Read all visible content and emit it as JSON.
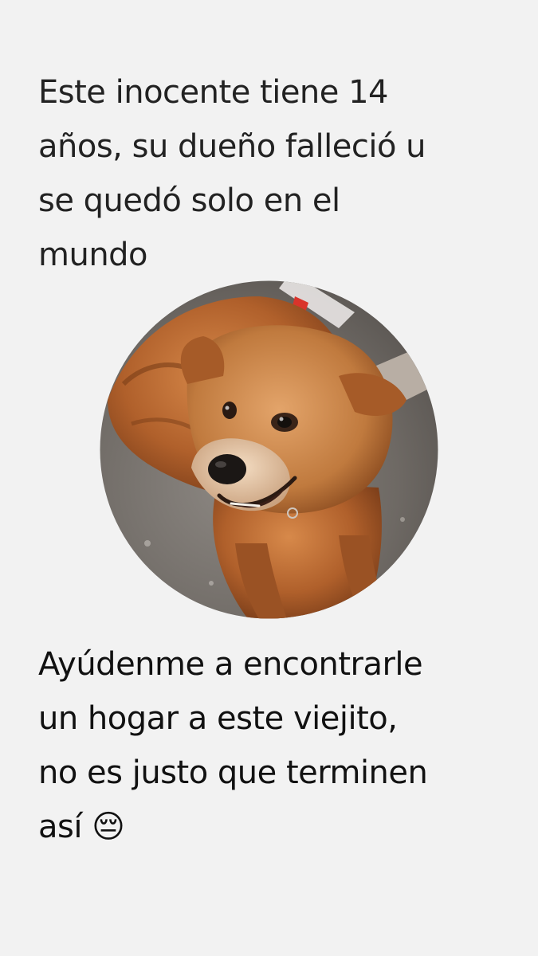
{
  "story": {
    "top_text": "Este inocente tiene 14\naños, su dueño falleció u\nse quedó solo en el\nmundo",
    "bottom_text": "Ayúdenme a encontrarle\nun hogar a este viejito,\nno es justo que terminen\nasí 😔"
  },
  "photo": {
    "subject": "dog"
  },
  "colors": {
    "background": "#f2f2f2",
    "text": "#222222",
    "fur": "#b5652c",
    "ground": "#6f6a66"
  }
}
